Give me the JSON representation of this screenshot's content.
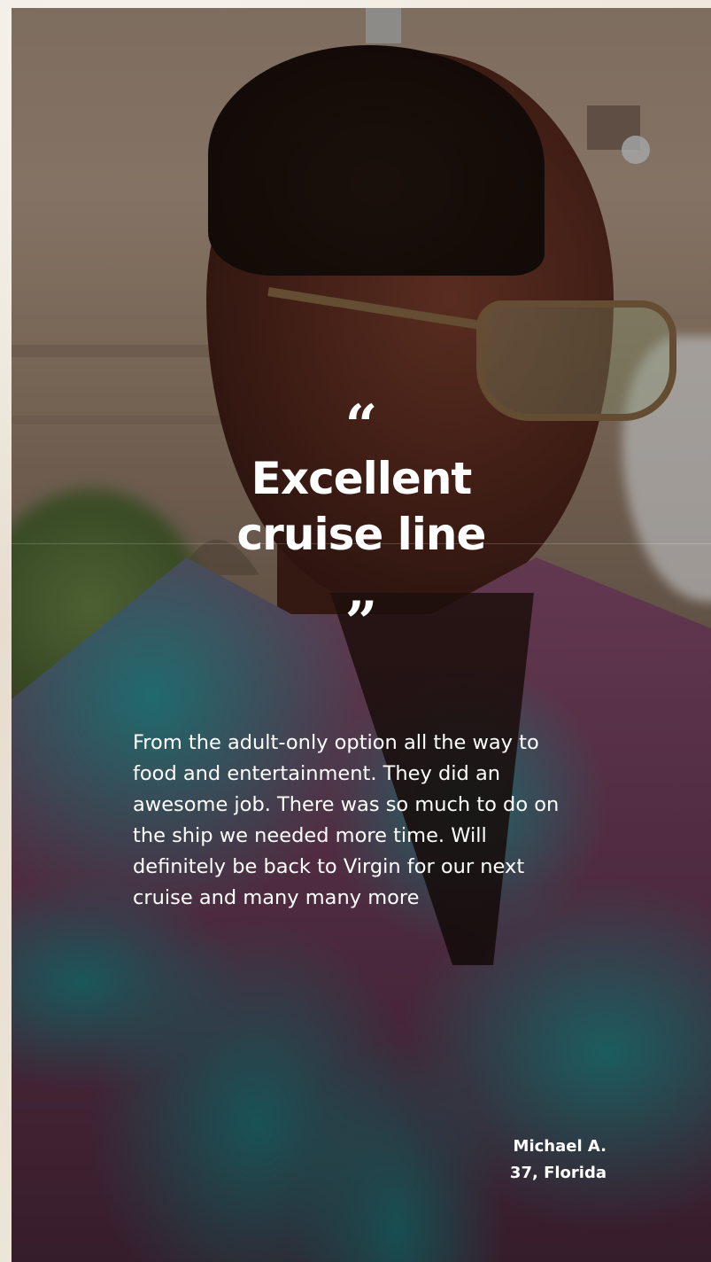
{
  "testimonial": {
    "open_quote": "“",
    "headline_line1": "Excellent",
    "headline_line2": "cruise line",
    "close_quote": "”",
    "body": "From the adult-only option all the way to food and entertainment. They did an awesome job. There was so much to do on the ship we needed more time. Will definitely be back to Virgin for our next cruise and many many more",
    "author_name": "Michael A.",
    "author_details": "37, Florida"
  },
  "colors": {
    "text": "#ffffff",
    "shirt_teal": "#2e9b9f",
    "shirt_magenta": "#8a4f70",
    "paper_background": "#e9e1d4"
  }
}
